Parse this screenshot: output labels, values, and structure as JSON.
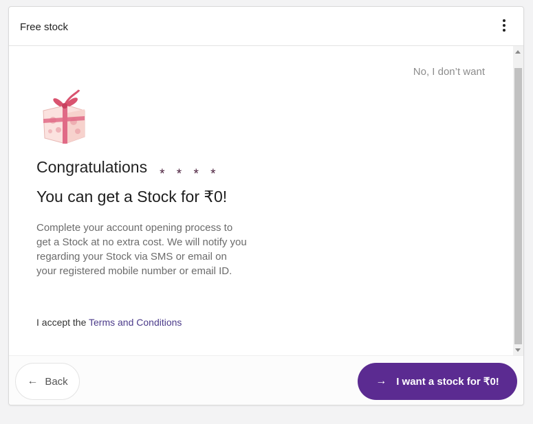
{
  "header": {
    "title": "Free stock",
    "menu_icon": "more-vertical-icon"
  },
  "content": {
    "skip_label": "No, I don’t want",
    "gift_icon": "gift-box-icon",
    "congrats": "Congratulations",
    "stars": "* * * *",
    "headline": "You can get a Stock for ₹0!",
    "description": "Complete your account opening process to get a Stock at no extra cost. We will notify you regarding your Stock via SMS or email on your registered mobile number or email ID.",
    "terms_prefix": "I accept the ",
    "terms_link": "Terms and Conditions"
  },
  "footer": {
    "back_label": "Back",
    "back_icon": "arrow-left-icon",
    "cta_label": "I want a stock for ₹0!",
    "cta_icon": "arrow-right-icon"
  },
  "colors": {
    "accent": "#5b2b91",
    "link": "#4b3b8a",
    "muted_text": "#8c8c8c",
    "gift_pink": "#e06a86"
  }
}
